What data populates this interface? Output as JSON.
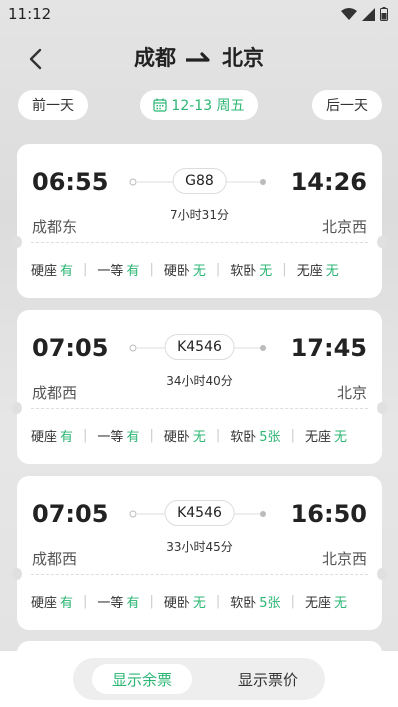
{
  "status_bar": {
    "time": "11:12"
  },
  "header": {
    "from": "成都",
    "to": "北京"
  },
  "date_nav": {
    "prev_label": "前一天",
    "current_date": "12-13 周五",
    "next_label": "后一天"
  },
  "trains": [
    {
      "dep_time": "06:55",
      "arr_time": "14:26",
      "train_no": "G88",
      "duration": "7小时31分",
      "dep_station": "成都东",
      "arr_station": "北京西",
      "seats": [
        {
          "label": "硬座",
          "value": "有"
        },
        {
          "label": "一等",
          "value": "有"
        },
        {
          "label": "硬卧",
          "value": "无"
        },
        {
          "label": "软卧",
          "value": "无"
        },
        {
          "label": "无座",
          "value": "无"
        }
      ]
    },
    {
      "dep_time": "07:05",
      "arr_time": "17:45",
      "train_no": "K4546",
      "duration": "34小时40分",
      "dep_station": "成都西",
      "arr_station": "北京",
      "seats": [
        {
          "label": "硬座",
          "value": "有"
        },
        {
          "label": "一等",
          "value": "有"
        },
        {
          "label": "硬卧",
          "value": "无"
        },
        {
          "label": "软卧",
          "value": "5张"
        },
        {
          "label": "无座",
          "value": "无"
        }
      ]
    },
    {
      "dep_time": "07:05",
      "arr_time": "16:50",
      "train_no": "K4546",
      "duration": "33小时45分",
      "dep_station": "成都西",
      "arr_station": "北京西",
      "seats": [
        {
          "label": "硬座",
          "value": "有"
        },
        {
          "label": "一等",
          "value": "有"
        },
        {
          "label": "硬卧",
          "value": "无"
        },
        {
          "label": "软卧",
          "value": "5张"
        },
        {
          "label": "无座",
          "value": "无"
        }
      ]
    }
  ],
  "bottom_toggle": {
    "show_remaining": "显示余票",
    "show_price": "显示票价"
  },
  "colors": {
    "accent": "#2bb673"
  }
}
